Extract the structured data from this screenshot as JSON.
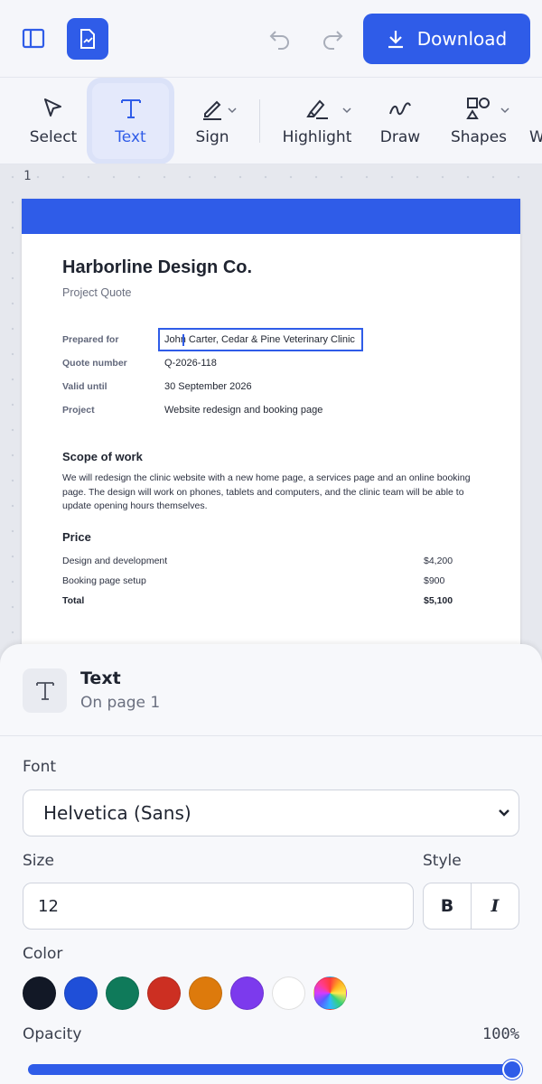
{
  "header": {
    "download_label": "Download"
  },
  "toolbar": {
    "tools": [
      {
        "label": "Select"
      },
      {
        "label": "Text"
      },
      {
        "label": "Sign"
      },
      {
        "label": "Highlight"
      },
      {
        "label": "Draw"
      },
      {
        "label": "Shapes"
      },
      {
        "label": "W"
      }
    ]
  },
  "canvas": {
    "page_number": "1"
  },
  "document": {
    "title": "Harborline Design Co.",
    "subtitle": "Project Quote",
    "fields": [
      {
        "label": "Prepared for",
        "value": "John Carter, Cedar & Pine Veterinary Clinic"
      },
      {
        "label": "Quote number",
        "value": "Q-2026-118"
      },
      {
        "label": "Valid until",
        "value": "30 September 2026"
      },
      {
        "label": "Project",
        "value": "Website redesign and booking page"
      }
    ],
    "scope_heading": "Scope of work",
    "scope_text": "We will redesign the clinic website with a new home page, a services page and an online booking page. The design will work on phones, tablets and computers, and the clinic team will be able to update opening hours themselves.",
    "price_heading": "Price",
    "price_rows": [
      {
        "label": "Design and development",
        "amount": "$4,200"
      },
      {
        "label": "Booking page setup",
        "amount": "$900"
      },
      {
        "label": "Total",
        "amount": "$5,100"
      }
    ]
  },
  "panel": {
    "title": "Text",
    "subtitle": "On page 1",
    "font_label": "Font",
    "font_value": "Helvetica (Sans)",
    "size_label": "Size",
    "size_value": "12",
    "style_label": "Style",
    "bold_label": "B",
    "italic_label": "I",
    "color_label": "Color",
    "colors": [
      "#121826",
      "#1f4fd8",
      "#0f7a5a",
      "#cc2f22",
      "#dd7a0c",
      "#7c3aed",
      "#ffffff",
      "rainbow"
    ],
    "opacity_label": "Opacity",
    "opacity_value": "100%",
    "opacity_level": 1.0
  },
  "theme": {
    "accent": "#2f5ce8"
  }
}
